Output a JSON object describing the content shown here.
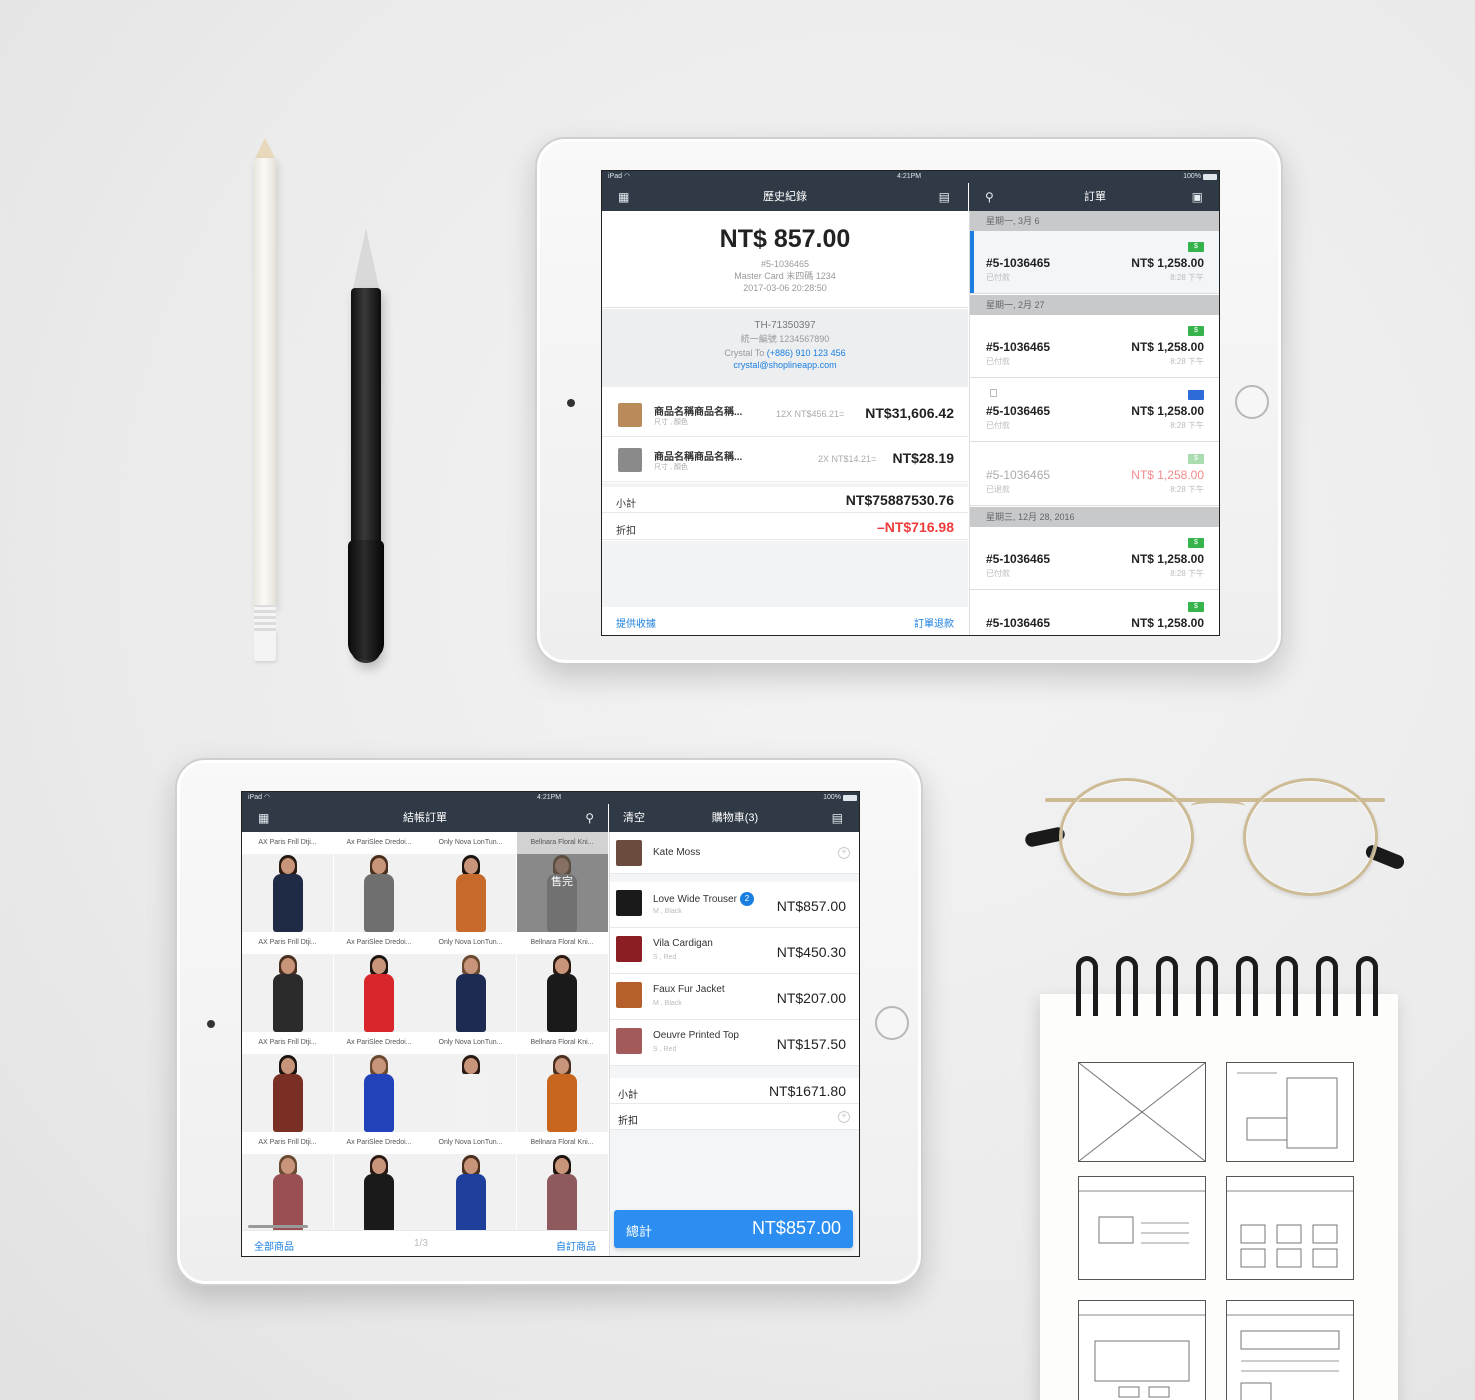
{
  "ipad1": {
    "status": {
      "device": "iPad",
      "time": "4:21PM",
      "battery": "100%"
    },
    "history_title": "歷史紀錄",
    "orders_title": "訂單",
    "summary": {
      "total": "NT$ 857.00",
      "order_no": "#5-1036465",
      "payment": "Master Card 末四碼 1234",
      "datetime": "2017-03-06 20:28:50"
    },
    "customer": {
      "tax_id": "TH-71350397",
      "unified_no": "統一編號 1234567890",
      "name_prefix": "Crystal To",
      "phone": "(+886) 910 123 456",
      "email": "crystal@shoplineapp.com"
    },
    "line_items": [
      {
        "name": "商品名稱商品名稱...",
        "variant": "尺寸 , 顏色",
        "qty": "12X NT$456.21=",
        "amount": "NT$31,606.42",
        "color": "#b98a5a"
      },
      {
        "name": "商品名稱商品名稱...",
        "variant": "尺寸 , 顏色",
        "qty": "2X NT$14.21=",
        "amount": "NT$28.19",
        "color": "#8a8a8a"
      }
    ],
    "subtotal_label": "小計",
    "subtotal": "NT$75887530.76",
    "discount_label": "折扣",
    "discount": "–NT$716.98",
    "footer_left": "提供收據",
    "footer_right": "訂單退款",
    "day_headers": [
      "星期一, 3月 6",
      "星期一, 2月 27",
      "星期三, 12月 28, 2016"
    ],
    "orders": [
      {
        "id": "#5-1036465",
        "status": "已付款",
        "amount": "NT$ 1,258.00",
        "time": "8:28 下午",
        "pay": "cash",
        "pay_text": "$"
      },
      {
        "id": "#5-1036465",
        "status": "已付款",
        "amount": "NT$ 1,258.00",
        "time": "8:28 下午",
        "pay": "cash",
        "pay_text": "$"
      },
      {
        "id": "#5-1036465",
        "status": "已付款",
        "amount": "NT$ 1,258.00",
        "time": "8:28 下午",
        "pay": "card",
        "pay_text": ""
      },
      {
        "id": "#5-1036465",
        "status": "已退款",
        "amount": "NT$ 1,258.00",
        "time": "8:28 下午",
        "pay": "cash-dim",
        "pay_text": "$"
      },
      {
        "id": "#5-1036465",
        "status": "已付款",
        "amount": "NT$ 1,258.00",
        "time": "8:28 下午",
        "pay": "cash",
        "pay_text": "$"
      },
      {
        "id": "#5-1036465",
        "status": "",
        "amount": "NT$ 1,258.00",
        "time": "",
        "pay": "cash",
        "pay_text": "$"
      }
    ]
  },
  "ipad2": {
    "status": {
      "device": "iPad",
      "time": "4:21PM",
      "battery": "100%"
    },
    "checkout_title": "結帳訂單",
    "clear_label": "清空",
    "cart_title": "購物車(3)",
    "product_labels": [
      "AX Paris Frill Dtji...",
      "Ax PariSlee Dredoi...",
      "Only Nova LonTun...",
      "Bellnara Floral Kni..."
    ],
    "sold_out": "售完",
    "tile_colors": [
      [
        "#1f2a44",
        "#6f6f6f",
        "#c76a2b",
        "#9a9a9a"
      ],
      [
        "#2b2b2b",
        "#d9262a",
        "#1d2b52",
        "#1a1a1a"
      ],
      [
        "#7a2f25",
        "#2142b8",
        "#f2f2f2",
        "#c8661f"
      ],
      [
        "#9a4f52",
        "#1a1a1a",
        "#1e3f9c",
        "#8e5a5e"
      ]
    ],
    "footer_left": "全部商品",
    "page": "1/3",
    "footer_right": "自訂商品",
    "customer_name": "Kate Moss",
    "cart_items": [
      {
        "name": "Love Wide Trouser",
        "qty": "2",
        "variant": "M , Black",
        "amount": "NT$857.00",
        "color": "#1a1a1a"
      },
      {
        "name": "Vila Cardigan",
        "qty": "",
        "variant": "S , Red",
        "amount": "NT$450.30",
        "color": "#8a1e22"
      },
      {
        "name": "Faux Fur Jacket",
        "qty": "",
        "variant": "M , Black",
        "amount": "NT$207.00",
        "color": "#b5602a"
      },
      {
        "name": "Oeuvre Printed Top",
        "qty": "",
        "variant": "S , Red",
        "amount": "NT$157.50",
        "color": "#a35a5a"
      }
    ],
    "subtotal_label": "小計",
    "subtotal": "NT$1671.80",
    "discount_label": "折扣",
    "total_label": "總計",
    "total": "NT$857.00"
  },
  "colors": {
    "navbar": "#2f3a46",
    "accent": "#1a7fe0",
    "danger": "#ee3b3b",
    "button": "#2b8ef0"
  },
  "icons": [
    "grid-icon",
    "clipboard-icon",
    "search-icon",
    "calendar-icon",
    "wifi-icon",
    "battery-icon",
    "plus-circle-icon",
    "cash-icon",
    "credit-card-icon"
  ]
}
